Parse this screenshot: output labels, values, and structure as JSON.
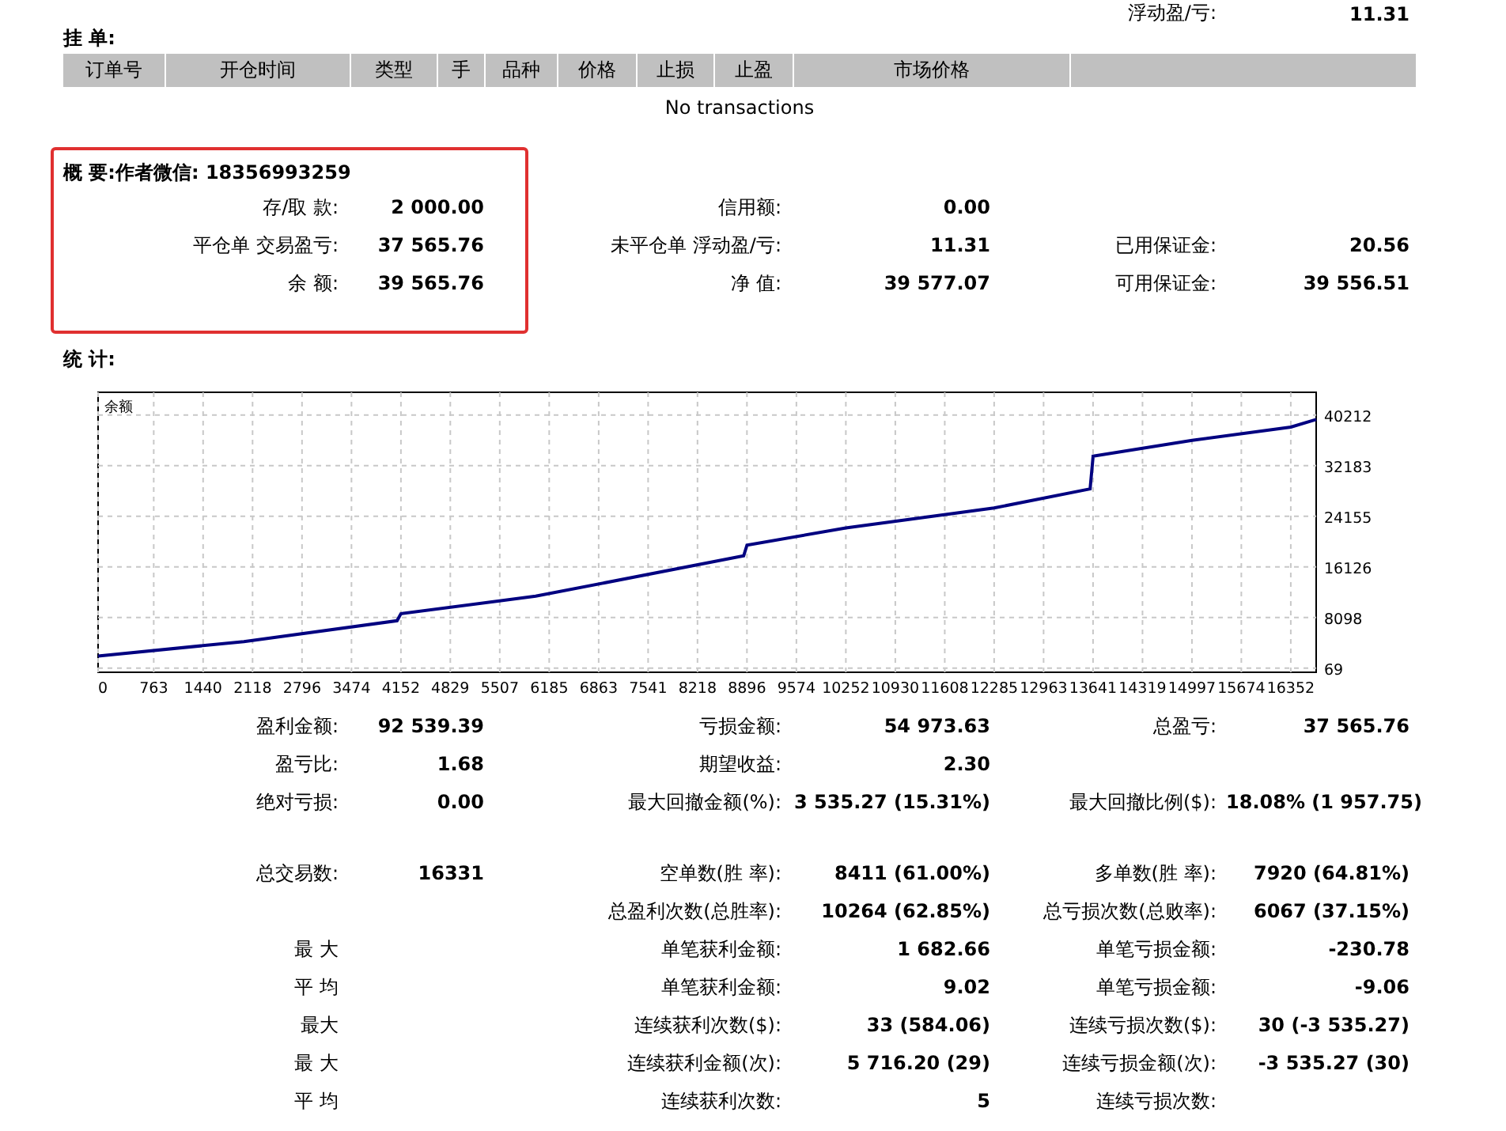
{
  "top_row": {
    "label": "浮动盈/亏:",
    "value": "11.31"
  },
  "pending_orders": {
    "title": "挂 单:",
    "columns": [
      "订单号",
      "开仓时间",
      "类型",
      "手",
      "品种",
      "价格",
      "止损",
      "止盈",
      "市场价格"
    ],
    "empty_text": "No transactions"
  },
  "summary": {
    "title": "概 要:作者微信: 18356993259",
    "highlighted": true,
    "rows": [
      {
        "left": {
          "label": "存/取 款:",
          "value": "2 000.00"
        },
        "middle": {
          "label": "信用额:",
          "value": "0.00"
        }
      },
      {
        "left": {
          "label": "平仓单 交易盈亏:",
          "value": "37 565.76"
        },
        "middle": {
          "label": "未平仓单 浮动盈/亏:",
          "value": "11.31"
        },
        "right": {
          "label": "已用保证金:",
          "value": "20.56"
        }
      },
      {
        "left": {
          "label": "余 额:",
          "value": "39 565.76"
        },
        "middle": {
          "label": "净 值:",
          "value": "39 577.07"
        },
        "right": {
          "label": "可用保证金:",
          "value": "39 556.51"
        }
      }
    ]
  },
  "statistics": {
    "title": "统 计:",
    "chart_data": {
      "type": "line",
      "grid": true,
      "x": [
        0,
        2000,
        4100,
        4152,
        6000,
        8850,
        8896,
        10252,
        12285,
        13600,
        13641,
        15000,
        16352,
        16700
      ],
      "series": [
        {
          "name": "余额",
          "color": "#000080",
          "values": [
            2000,
            4300,
            7600,
            8700,
            11500,
            17900,
            19600,
            22300,
            25500,
            28500,
            33700,
            36200,
            38300,
            39500
          ]
        }
      ],
      "xlim": [
        0,
        16700
      ],
      "ylim": [
        -700,
        43700
      ],
      "xticks": [
        0,
        763,
        1440,
        2118,
        2796,
        3474,
        4152,
        4829,
        5507,
        6185,
        6863,
        7541,
        8218,
        8896,
        9574,
        10252,
        10930,
        11608,
        12285,
        12963,
        13641,
        14319,
        14997,
        15674,
        16352
      ],
      "yticks": [
        69,
        8098,
        16126,
        24155,
        32183,
        40212
      ]
    },
    "groups": [
      [
        {
          "left": {
            "label": "盈利金额:",
            "value": "92 539.39"
          },
          "middle": {
            "label": "亏损金额:",
            "value": "54 973.63"
          },
          "right": {
            "label": "总盈亏:",
            "value": "37 565.76"
          }
        },
        {
          "left": {
            "label": "盈亏比:",
            "value": "1.68"
          },
          "middle": {
            "label": "期望收益:",
            "value": "2.30"
          }
        },
        {
          "left": {
            "label": "绝对亏损:",
            "value": "0.00"
          },
          "middle": {
            "label": "最大回撤金额(%):",
            "value": "3 535.27 (15.31%)"
          },
          "right": {
            "label": "最大回撤比例($):",
            "value": "18.08% (1 957.75)"
          }
        }
      ],
      [
        {
          "left": {
            "label": "总交易数:",
            "value": "16331"
          },
          "middle": {
            "label": "空单数(胜 率):",
            "value": "8411 (61.00%)"
          },
          "right": {
            "label": "多单数(胜 率):",
            "value": "7920 (64.81%)"
          }
        },
        {
          "middle": {
            "label": "总盈利次数(总胜率):",
            "value": "10264 (62.85%)"
          },
          "right": {
            "label": "总亏损次数(总败率):",
            "value": "6067 (37.15%)"
          }
        },
        {
          "left": {
            "label": "最 大"
          },
          "middle": {
            "label": "单笔获利金额:",
            "value": "1 682.66"
          },
          "right": {
            "label": "单笔亏损金额:",
            "value": "-230.78"
          }
        },
        {
          "left": {
            "label": "平 均"
          },
          "middle": {
            "label": "单笔获利金额:",
            "value": "9.02"
          },
          "right": {
            "label": "单笔亏损金额:",
            "value": "-9.06"
          }
        },
        {
          "left": {
            "label": "最大"
          },
          "middle": {
            "label": "连续获利次数($):",
            "value": "33 (584.06)"
          },
          "right": {
            "label": "连续亏损次数($):",
            "value": "30 (-3 535.27)"
          }
        },
        {
          "left": {
            "label": "最 大"
          },
          "middle": {
            "label": "连续获利金额(次):",
            "value": "5 716.20 (29)"
          },
          "right": {
            "label": "连续亏损金额(次):",
            "value": "-3 535.27 (30)"
          }
        },
        {
          "left": {
            "label": "平 均"
          },
          "middle": {
            "label": "连续获利次数:",
            "value": "5"
          },
          "right": {
            "label": "连续亏损次数:"
          }
        }
      ]
    ]
  }
}
